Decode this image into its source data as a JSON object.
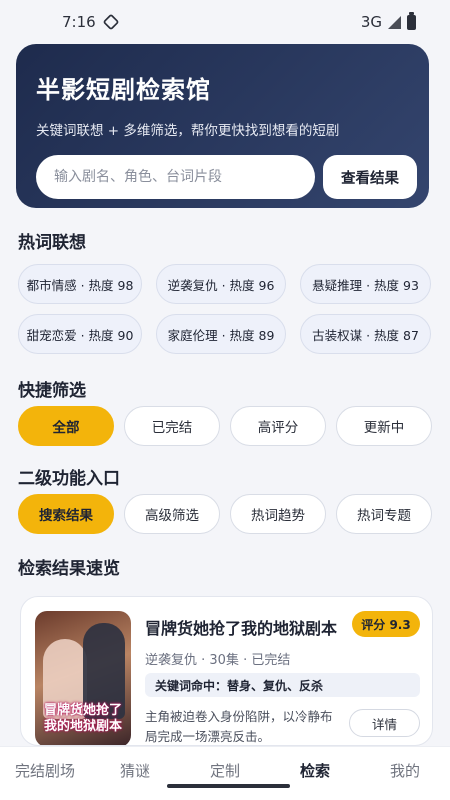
{
  "status_bar": {
    "time": "7:16",
    "network": "3G"
  },
  "hero": {
    "title": "半影短剧检索馆",
    "subtitle": "关键词联想 + 多维筛选，帮你更快找到想看的短剧",
    "search_placeholder": "输入剧名、角色、台词片段",
    "search_button": "查看结果"
  },
  "hot_words": {
    "title": "热词联想",
    "items": [
      "都市情感 · 热度 98",
      "逆袭复仇 · 热度 96",
      "悬疑推理 · 热度 93",
      "甜宠恋爱 · 热度 90",
      "家庭伦理 · 热度 89",
      "古装权谋 · 热度 87"
    ]
  },
  "quick_filter": {
    "title": "快捷筛选",
    "items": [
      "全部",
      "已完结",
      "高评分",
      "更新中"
    ],
    "active_index": 0
  },
  "secondary": {
    "title": "二级功能入口",
    "items": [
      "搜索结果",
      "高级筛选",
      "热词趋势",
      "热词专题"
    ],
    "active_index": 0
  },
  "results": {
    "title": "检索结果速览",
    "card": {
      "title": "冒牌货她抢了我的地狱剧本",
      "score": "评分 9.3",
      "meta": "逆袭复仇 · 30集 · 已完结",
      "keywords": "关键词命中：替身、复仇、反杀",
      "description": "主角被迫卷入身份陷阱，以冷静布局完成一场漂亮反击。",
      "detail_button": "详情",
      "poster_text": "冒牌货她抢了我的地狱剧本"
    }
  },
  "bottom_nav": {
    "items": [
      "完结剧场",
      "猜谜",
      "定制",
      "检索",
      "我的"
    ],
    "active_index": 3
  },
  "colors": {
    "accent": "#f3b40b",
    "hero_start": "#1e2b4d",
    "hero_end": "#34456e",
    "background": "#f4f5f9"
  }
}
